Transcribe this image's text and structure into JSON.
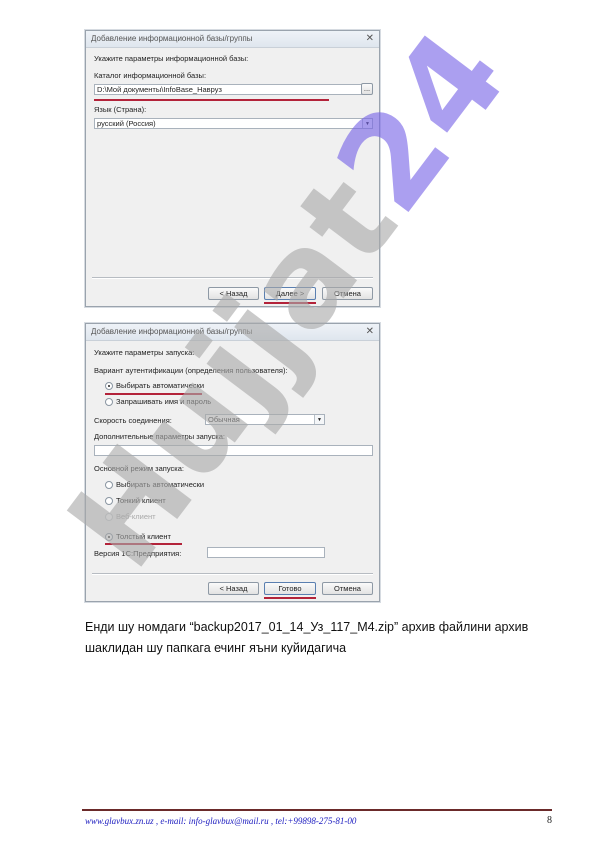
{
  "dialog1": {
    "title": "Добавление информационной базы/группы",
    "prompt": "Укажите параметры информационной базы:",
    "catalog_label": "Каталог информационной базы:",
    "catalog_value": "D:\\Мой документы\\InfoBase_Навруз",
    "browse_label": "...",
    "language_label": "Язык (Страна):",
    "language_value": "русский (Россия)",
    "back_label": "< Назад",
    "next_label": "Далее >",
    "cancel_label": "Отмена"
  },
  "dialog2": {
    "title": "Добавление информационной базы/группы",
    "prompt": "Укажите параметры запуска:",
    "auth_label": "Вариант аутентификации (определения пользователя):",
    "auth_options": [
      "Выбирать автоматически",
      "Запрашивать имя и пароль"
    ],
    "auth_selected": 0,
    "speed_label": "Скорость соединения:",
    "speed_value": "Обычная",
    "extra_label": "Дополнительные параметры запуска:",
    "extra_value": "",
    "mode_label": "Основной режим запуска:",
    "mode_options": [
      "Выбирать автоматически",
      "Тонкий клиент",
      "Веб-клиент",
      "Толстый клиент"
    ],
    "mode_selected": 3,
    "version_label": "Версия 1С:Предприятия:",
    "version_value": "",
    "back_label": "< Назад",
    "finish_label": "Готово",
    "cancel_label": "Отмена"
  },
  "watermark": {
    "text": "Hujjat",
    "number": "24"
  },
  "paragraph": "Енди шу номдаги “backup2017_01_14_Уз_117_M4.zip” архив файлини архив шаклидан шу папкага ечинг яъни куйидагича",
  "footer": {
    "text": "www.glavbux.zn.uz , e-mail: info-glavbux@mail.ru , tel:+99898-275-81-00",
    "page": "8"
  }
}
